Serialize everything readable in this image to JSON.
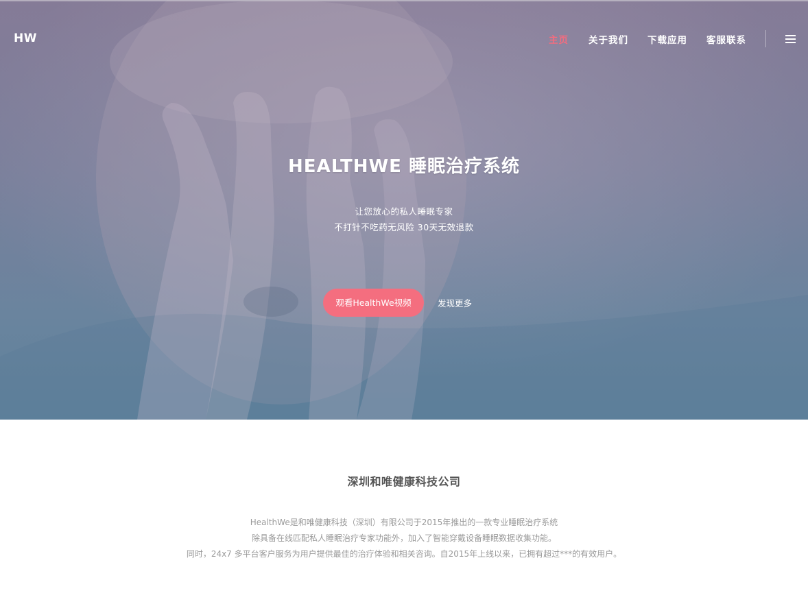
{
  "brand": {
    "logo": "HW"
  },
  "nav": {
    "items": [
      {
        "label": "主页",
        "active": true
      },
      {
        "label": "关于我们",
        "active": false
      },
      {
        "label": "下载应用",
        "active": false
      },
      {
        "label": "客服联系",
        "active": false
      }
    ],
    "menu_icon": "hamburger-menu-icon"
  },
  "hero": {
    "title": "HEALTHWE 睡眠治疗系统",
    "subtitle_lines": [
      "让您放心的私人睡眠专家",
      "不打针不吃药无风险 30天无效退款"
    ],
    "primary_button": "观看HealthWe视频",
    "secondary_link": "发现更多"
  },
  "about": {
    "title": "深圳和唯健康科技公司",
    "paragraph_lines": [
      "HealthWe是和唯健康科技（深圳）有限公司于2015年推出的一款专业睡眠治疗系统",
      "除具备在线匹配私人睡眠治疗专家功能外，加入了智能穿戴设备睡眠数据收集功能。",
      "同时，24x7 多平台客户服务为用户提供最佳的治疗体验和相关咨询。自2015年上线以来，已拥有超过***的有效用户。"
    ]
  },
  "colors": {
    "accent": "#f56c7e",
    "button": "#f46e7f",
    "hero_top": "#857b97",
    "hero_bottom": "#5d819b",
    "body_text": "#9a9a9a",
    "heading_text": "#555555"
  }
}
